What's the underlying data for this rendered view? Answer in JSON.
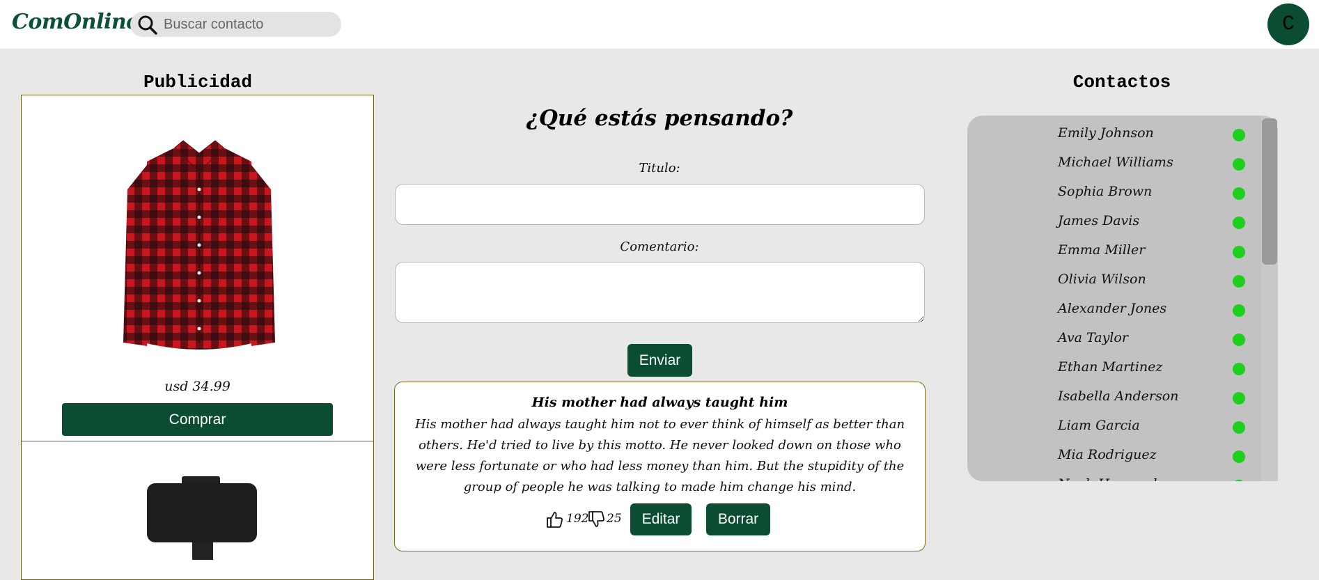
{
  "header": {
    "logo": "ComOnline",
    "search_placeholder": "Buscar contacto",
    "avatar_letter": "C"
  },
  "ads": {
    "title": "Publicidad",
    "items": [
      {
        "product_icon": "plaid-shirt-image",
        "price": "usd 34.99",
        "button": "Comprar"
      },
      {
        "product_icon": "phone-holder-image"
      }
    ]
  },
  "post_form": {
    "title": "¿Qué estás pensando?",
    "title_label": "Titulo:",
    "comment_label": "Comentario:",
    "send_button": "Enviar"
  },
  "post": {
    "title": "His mother had always taught him",
    "body": "His mother had always taught him not to ever think of himself as better than others. He'd tried to live by this motto. He never looked down on those who were less fortunate or who had less money than him. But the stupidity of the group of people he was talking to made him change his mind.",
    "likes": "192",
    "dislikes": "25",
    "edit_button": "Editar",
    "delete_button": "Borrar"
  },
  "contacts": {
    "title": "Contactos",
    "status_color": "#1ecf1e",
    "list": [
      "Emily Johnson",
      "Michael Williams",
      "Sophia Brown",
      "James Davis",
      "Emma Miller",
      "Olivia Wilson",
      "Alexander Jones",
      "Ava Taylor",
      "Ethan Martinez",
      "Isabella Anderson",
      "Liam Garcia",
      "Mia Rodriguez",
      "Noah Hernandez"
    ]
  },
  "colors": {
    "brand": "#0b4d33",
    "background": "#e8e8e8"
  }
}
